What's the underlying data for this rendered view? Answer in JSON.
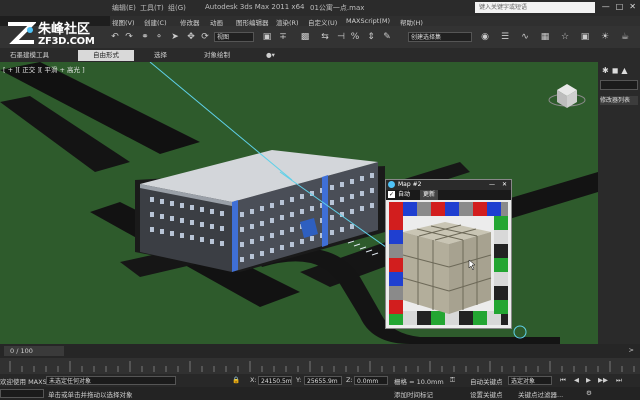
{
  "titlebar": {
    "menu1": "编辑(E)",
    "menu2": "工具(T)",
    "menu3": "组(G)",
    "menu4": "视图(V)",
    "menu5": "创建(C)",
    "menu6": "修改器",
    "menu7": "动画",
    "menu8": "图形编辑器",
    "menu9": "渲染(R)",
    "menu10": "自定义(U)",
    "menu11": "MAXScript(M)",
    "menu12": "帮助(H)",
    "app_title": "Autodesk 3ds Max  2011 x64",
    "file_title": "01公寓一点.max",
    "search_placeholder": "键入关键字或短语"
  },
  "logo": {
    "brand1": "朱峰社区",
    "brand2": "ZF3D.COM"
  },
  "toolbar": {
    "view_dropdown": "视图",
    "selection_set": "创建选择集"
  },
  "ribbon": {
    "tabs": [
      "石墨建模工具",
      "自由形式",
      "选择",
      "对象绘制"
    ]
  },
  "viewport": {
    "label": "[ + ][ 正交 ][ 平滑 + 高光 ]"
  },
  "sidepanel": {
    "tab_label": "修改器列表"
  },
  "map_window": {
    "title": "Map #2",
    "checkbox_label": "自动",
    "button_label": "更新",
    "face_colors": [
      "#d21e1e",
      "#23a632",
      "#1f3fd0",
      "#d8d8d8",
      "#8a8a8a",
      "#222222"
    ]
  },
  "timebar": {
    "frame": "0 / 100"
  },
  "status": {
    "selection_info": "未选定任何对象",
    "hint": "单击或单击并拖动以选择对象",
    "welcome": "欢迎使用 MAXSc",
    "x_label": "X:",
    "x_value": "24150.5m",
    "y_label": "Y:",
    "y_value": "25655.9m",
    "z_label": "Z:",
    "z_value": "0.0mm",
    "grid": "栅格 = 10.0mm",
    "autokey": "自动关键点",
    "setkey": "设置关键点",
    "add_time_tag": "添加时间标记",
    "selected": "选定对象",
    "key_filters": "关键点过滤器..."
  }
}
